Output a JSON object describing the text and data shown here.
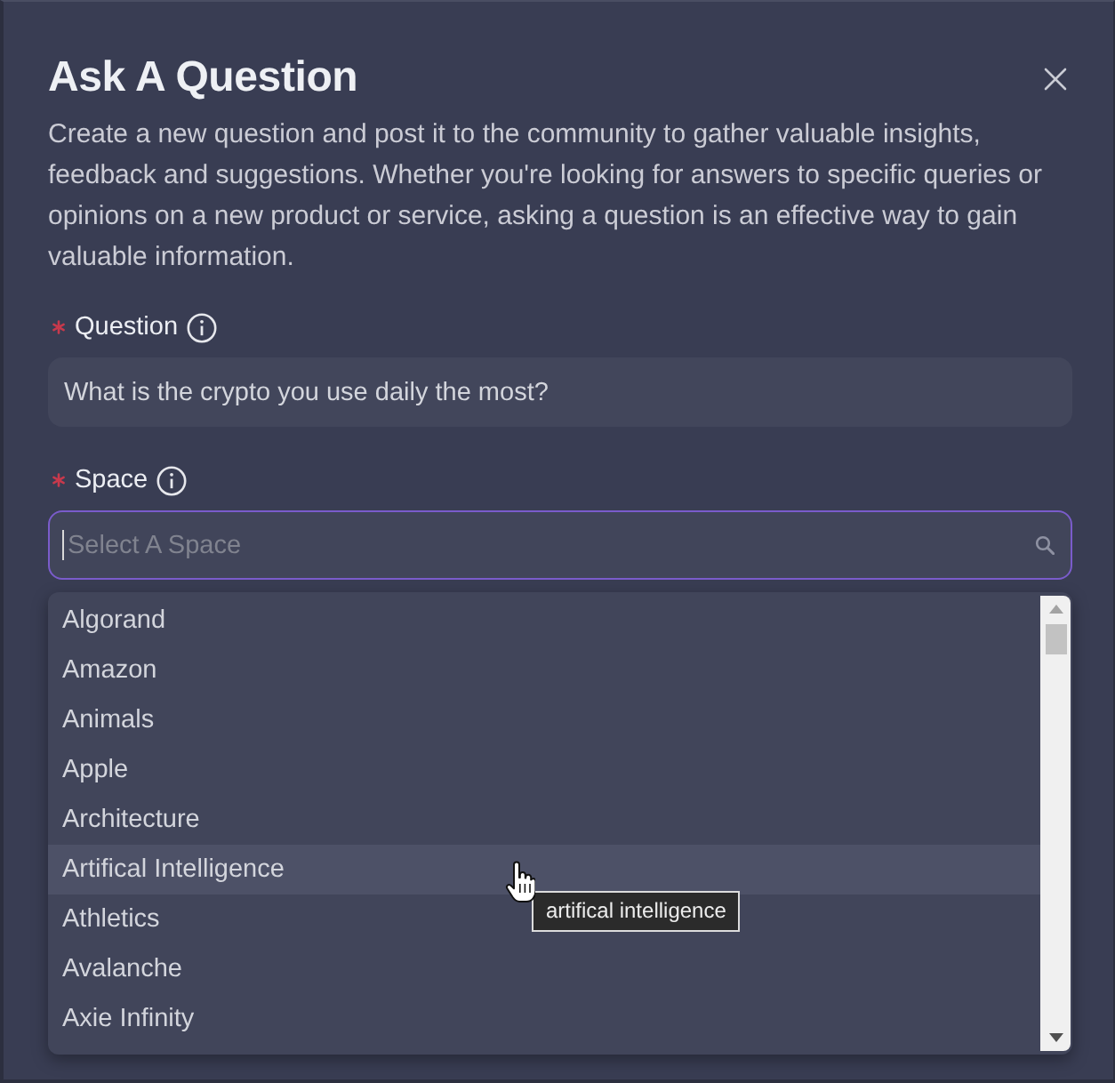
{
  "dialog": {
    "title": "Ask A Question",
    "description": "Create a new question and post it to the community to gather valuable insights, feedback and suggestions. Whether you're looking for answers to specific queries or opinions on a new product or service, asking a question is an effective way to gain valuable information."
  },
  "fields": [
    {
      "kind": "text",
      "label": "Question",
      "required": true,
      "focused": false,
      "value": "What is the crypto you use daily the most?"
    },
    {
      "kind": "select",
      "label": "Space",
      "required": true,
      "focused": true,
      "placeholder": "Select A Space"
    }
  ],
  "dropdown": {
    "options": [
      {
        "label": "Algorand",
        "hovered": false
      },
      {
        "label": "Amazon",
        "hovered": false
      },
      {
        "label": "Animals",
        "hovered": false
      },
      {
        "label": "Apple",
        "hovered": false
      },
      {
        "label": "Architecture",
        "hovered": false
      },
      {
        "label": "Artifical Intelligence",
        "hovered": true
      },
      {
        "label": "Athletics",
        "hovered": false
      },
      {
        "label": "Avalanche",
        "hovered": false
      },
      {
        "label": "Axie Infinity",
        "hovered": false
      }
    ],
    "tooltip": "artifical intelligence"
  }
}
